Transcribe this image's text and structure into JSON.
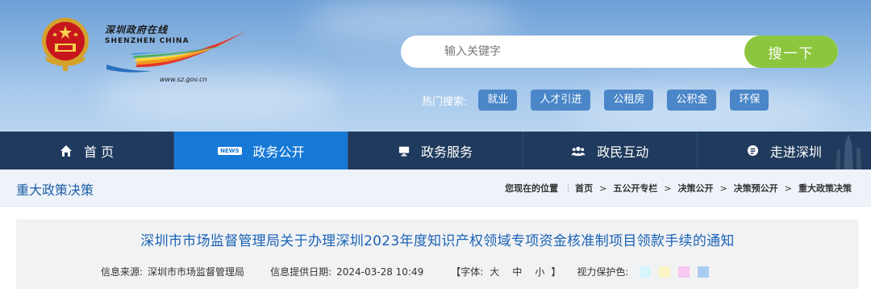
{
  "logo": {
    "chinese": "深圳政府在线",
    "english": "SHENZHEN CHINA",
    "url": "www.sz.gov.cn"
  },
  "search": {
    "placeholder": "输入关键字",
    "button": "搜一下"
  },
  "hot": {
    "label": "热门搜索:",
    "tags": [
      "就业",
      "人才引进",
      "公租房",
      "公积金",
      "环保"
    ]
  },
  "nav": {
    "items": [
      {
        "label": "首 页",
        "icon": "home-icon"
      },
      {
        "label": "政务公开",
        "icon": "news-icon"
      },
      {
        "label": "政务服务",
        "icon": "monitor-icon"
      },
      {
        "label": "政民互动",
        "icon": "people-icon"
      },
      {
        "label": "走进深圳",
        "icon": "info-icon"
      }
    ],
    "active_index": 1
  },
  "section": {
    "title": "重大政策决策"
  },
  "breadcrumb": {
    "here": "您现在的位置",
    "items": [
      "首页",
      "五公开专栏",
      "决策公开",
      "决策预公开",
      "重大政策决策"
    ],
    "separator": ">"
  },
  "article": {
    "title": "深圳市市场监督管理局关于办理深圳2023年度知识产权领域专项资金核准制项目领款手续的通知",
    "source_label": "信息来源:",
    "source": "深圳市市场监督管理局",
    "date_label": "信息提供日期:",
    "date": "2024-03-28 10:49",
    "font_label": "【字体:",
    "font_large": "大",
    "font_medium": "中",
    "font_small": "小",
    "font_close": "】",
    "eye_label": "视力保护色:",
    "eye_colors": [
      "#d6f4fb",
      "#fbf5c4",
      "#f7c6f1",
      "#a9cdf2"
    ]
  },
  "colors": {
    "nav_bg": "#1f3a5c",
    "nav_active": "#1779d6",
    "search_button": "#8cc63f",
    "hot_tag": "#4a86c8",
    "title_blue": "#1a63b5"
  }
}
